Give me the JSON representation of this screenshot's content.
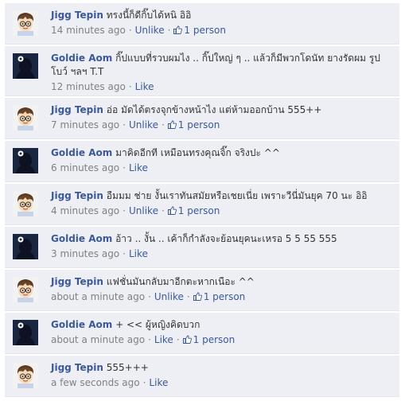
{
  "comments": [
    {
      "author": "Jigg Tepin",
      "text": "ทรงนี้ก็ดีกิ๊บได้หนิ อิอิ",
      "time": "14 minutes ago",
      "action": "Unlike",
      "likes": "1 person",
      "avatar": "cartoon-boy"
    },
    {
      "author": "Goldie Aom",
      "text": "กิ๊ปแบบที่รวบผมไง .. กิ๊ปใหญ่ ๆ .. แล้วก็มีพวกโดนัท ยางรัดผม รูปโบว์ ฯลฯ T.T",
      "time": "12 minutes ago",
      "action": "Like",
      "likes": "",
      "avatar": "silhouette"
    },
    {
      "author": "Jigg Tepin",
      "text": "อ่อ มัดได้ตรงจุกข้างหน้าไง แต่ห้ามออกบ้าน 555++",
      "time": "7 minutes ago",
      "action": "Unlike",
      "likes": "1 person",
      "avatar": "cartoon-boy"
    },
    {
      "author": "Goldie Aom",
      "text": "มาคิดอีกที เหมือนทรงคุณจิ๊ก จริงปะ ^^",
      "time": "6 minutes ago",
      "action": "Like",
      "likes": "",
      "avatar": "silhouette"
    },
    {
      "author": "Jigg Tepin",
      "text": "อืมมม ช่าย งั้นเราทันสมัยหรือเชยเนี่ย เพราะวีนี่มันยุค 70 นะ อิอิ",
      "time": "4 minutes ago",
      "action": "Unlike",
      "likes": "1 person",
      "avatar": "cartoon-boy"
    },
    {
      "author": "Goldie Aom",
      "text": "อ้าว .. งั้น .. เค้าก็กำลังจะย้อนยุคนะเหรอ 5 5 55 555",
      "time": "3 minutes ago",
      "action": "Like",
      "likes": "",
      "avatar": "silhouette"
    },
    {
      "author": "Jigg Tepin",
      "text": "แฟชั่นมันกลับมาอีกตะหากเนือะ ^^",
      "time": "about a minute ago",
      "action": "Unlike",
      "likes": "1 person",
      "avatar": "cartoon-boy"
    },
    {
      "author": "Goldie Aom",
      "text": "+ << ผู้หญิงคิดบวก",
      "time": "about a minute ago",
      "action": "Like",
      "likes": "1 person",
      "avatar": "silhouette"
    },
    {
      "author": "Jigg Tepin",
      "text": "555+++",
      "time": "a few seconds ago",
      "action": "Like",
      "likes": "",
      "avatar": "cartoon-boy"
    }
  ],
  "separator": "·",
  "colors": {
    "link": "#3b5998",
    "bg": "#edeff4",
    "meta": "#808080"
  }
}
